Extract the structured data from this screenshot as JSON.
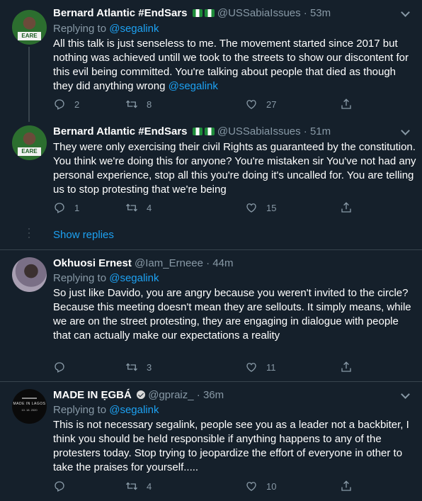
{
  "tweets": [
    {
      "name": "Bernard Atlantic #EndSars",
      "handle": "@USSabiaIssues",
      "time": "· 53m",
      "reply_prefix": "Replying to",
      "reply_to": "@segalink",
      "body_text": "All this talk is just senseless to me. The movement started since 2017 but nothing was achieved untill we took to the streets to show our discontent for this evil being committed. You're talking about people that died as though they did anything wrong",
      "body_mention": "@segalink",
      "replies": "2",
      "retweets": "8",
      "likes": "27",
      "avatar_badge": "EARE"
    },
    {
      "name": "Bernard Atlantic #EndSars",
      "handle": "@USSabiaIssues",
      "time": "· 51m",
      "body_text": "They were only exercising their civil Rights as guaranteed by the constitution. You think we're doing this for anyone? You're mistaken sir You've not had any personal experience, stop all this you're doing it's uncalled for. You are telling us to stop protesting that we're being",
      "replies": "1",
      "retweets": "4",
      "likes": "15",
      "avatar_badge": "EARE"
    },
    {
      "name": "Okhuosi Ernest",
      "handle": "@Iam_Erneee",
      "time": "· 44m",
      "reply_prefix": "Replying to",
      "reply_to": "@segalink",
      "body_p1": "So just like Davido, you are angry because you weren't invited to the circle?",
      "body_p2": "Because this meeting doesn't mean they are sellouts. It simply means, while we are on the street protesting, they are engaging in dialogue with people that can actually make our expectations a reality",
      "retweets": "3",
      "likes": "11"
    },
    {
      "name": "MADE IN ẸGBÁ",
      "handle": "@gpraiz_",
      "time": "· 36m",
      "reply_prefix": "Replying to",
      "reply_to": "@segalink",
      "body_text": "This is not necessary segalink, people see you as a leader not a backbiter, I think you should be held responsible if anything happens to any of the protesters today. Stop trying to jeopardize the effort of everyone in other to take the praises for yourself.....",
      "retweets": "4",
      "likes": "10",
      "avatar_text": "MADE IN LAGOS",
      "avatar_date": "10. 18. 2020"
    }
  ],
  "show_replies": "Show replies",
  "colors": {
    "background": "#15202b",
    "secondary_text": "#8899a6",
    "accent": "#1da1f2",
    "divider": "#38444d"
  },
  "icons": [
    "reply-icon",
    "retweet-icon",
    "like-icon",
    "share-icon",
    "chevron-down-icon",
    "verified-icon",
    "nigeria-flag-icon"
  ]
}
